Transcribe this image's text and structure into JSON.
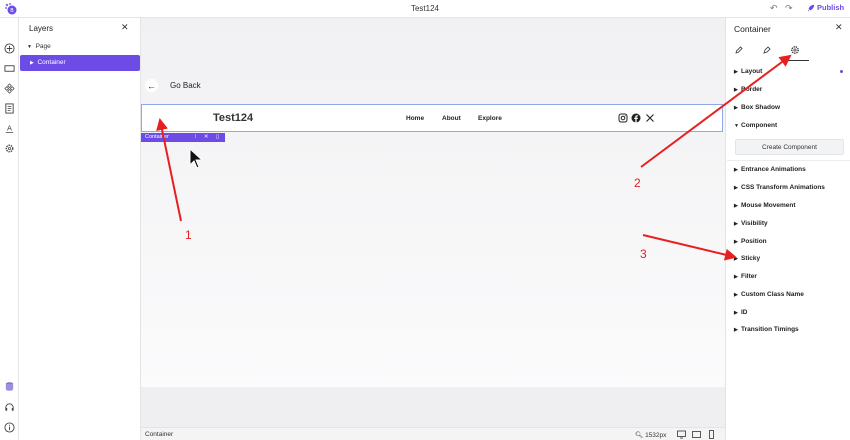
{
  "app": {
    "title": "Test124",
    "publish_label": "Publish",
    "accent": "#6d4ce6"
  },
  "toolbar": {
    "undo_icon": "undo-icon",
    "redo_icon": "redo-icon"
  },
  "rail": {
    "icons": [
      "add-icon",
      "section-icon",
      "components-icon",
      "pages-icon",
      "typography-icon",
      "settings-icon",
      "database-icon",
      "support-icon",
      "info-icon"
    ]
  },
  "layers": {
    "title": "Layers",
    "items": [
      {
        "label": "Page",
        "level": 0
      },
      {
        "label": "Container",
        "level": 1,
        "selected": true
      }
    ]
  },
  "canvas": {
    "back_label": "Go Back",
    "site_title": "Test124",
    "nav": [
      "Home",
      "About",
      "Explore"
    ],
    "social_icons": [
      "instagram-icon",
      "facebook-icon",
      "x-icon"
    ],
    "selected_tag": "Container",
    "status_label": "Container",
    "zoom": "1532px"
  },
  "props": {
    "title": "Container",
    "tabs": [
      "edit-icon",
      "style-icon",
      "settings-icon"
    ],
    "active_tab": 2,
    "sections": [
      {
        "label": "Layout",
        "open": false
      },
      {
        "label": "Border",
        "open": false
      },
      {
        "label": "Box Shadow",
        "open": false
      },
      {
        "label": "Component",
        "open": true
      },
      {
        "label": "Entrance Animations",
        "open": false
      },
      {
        "label": "CSS Transform Animations",
        "open": false
      },
      {
        "label": "Mouse Movement",
        "open": false
      },
      {
        "label": "Visibility",
        "open": false
      },
      {
        "label": "Position",
        "open": false
      },
      {
        "label": "Sticky",
        "open": false
      },
      {
        "label": "Filter",
        "open": false
      },
      {
        "label": "Custom Class Name",
        "open": false
      },
      {
        "label": "ID",
        "open": false
      },
      {
        "label": "Transition Timings",
        "open": false
      }
    ],
    "create_component_label": "Create Component"
  },
  "annotations": [
    "1",
    "2",
    "3"
  ]
}
